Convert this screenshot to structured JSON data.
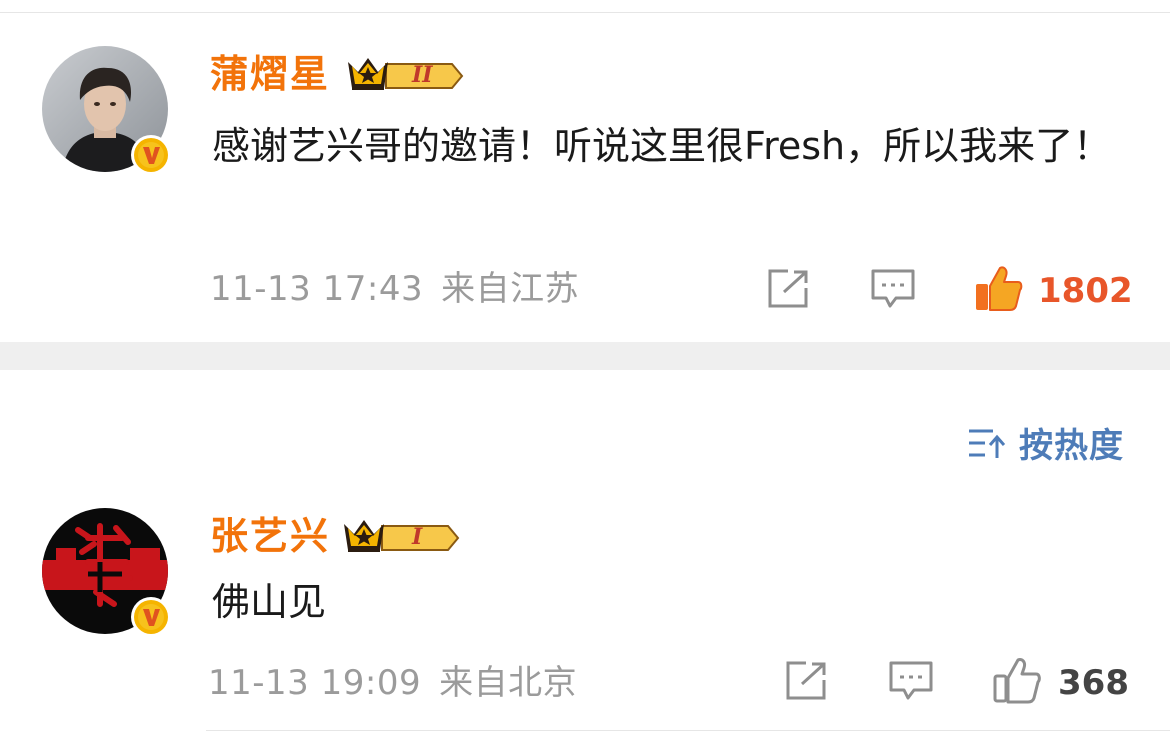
{
  "comments": [
    {
      "username": "蒲熠星",
      "rank": "II",
      "text": "感谢艺兴哥的邀请！听说这里很Fresh，所以我来了！",
      "date": "11-13 17:43",
      "source": "来自江苏",
      "likes": "1802",
      "liked": true
    },
    {
      "username": "张艺兴",
      "rank": "I",
      "text": "佛山见",
      "date": "11-13 19:09",
      "source": "来自北京",
      "likes": "368",
      "liked": false
    }
  ],
  "sort": {
    "label": "按热度",
    "icon": "sort-icon"
  },
  "icons": {
    "repost": "share-icon",
    "comment": "comment-icon",
    "like": "thumbs-up-icon",
    "verified": "verified-v-icon",
    "crown": "crown-icon"
  },
  "colors": {
    "username": "#f2730a",
    "like_active": "#e8562a",
    "sort": "#4e7cb8",
    "meta": "#9b9b9b",
    "separator": "#efefef",
    "badge_gold": "#f5b400"
  }
}
